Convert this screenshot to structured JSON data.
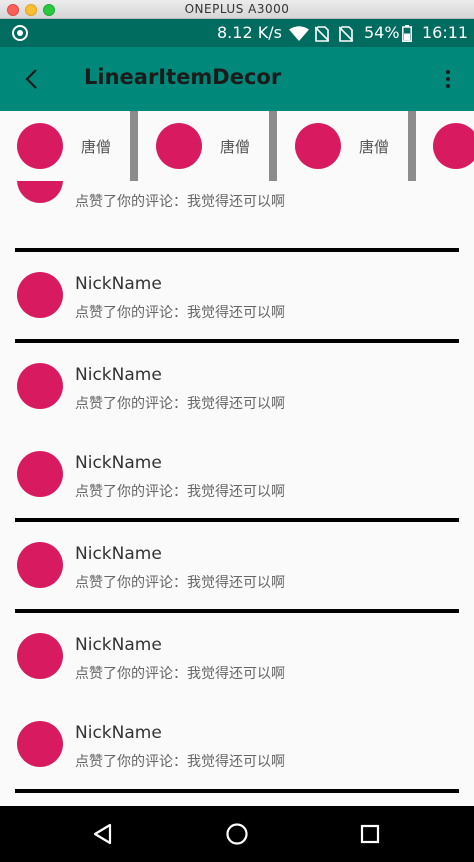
{
  "window": {
    "title": "ONEPLUS A3000"
  },
  "status_bar": {
    "net_speed": "8.12 K/s",
    "battery": "54%",
    "time": "16:11"
  },
  "app_bar": {
    "title": "LinearItemDecor"
  },
  "horizontal_list": {
    "items": [
      {
        "name": "唐僧"
      },
      {
        "name": "唐僧"
      },
      {
        "name": "唐僧"
      },
      {
        "name": ""
      }
    ]
  },
  "vertical_list": {
    "items": [
      {
        "nickname": "",
        "comment": "点赞了你的评论：我觉得还可以啊"
      },
      {
        "nickname": "NickName",
        "comment": "点赞了你的评论：我觉得还可以啊"
      },
      {
        "nickname": "NickName",
        "comment": "点赞了你的评论：我觉得还可以啊"
      },
      {
        "nickname": "NickName",
        "comment": "点赞了你的评论：我觉得还可以啊"
      },
      {
        "nickname": "NickName",
        "comment": "点赞了你的评论：我觉得还可以啊"
      },
      {
        "nickname": "NickName",
        "comment": "点赞了你的评论：我觉得还可以啊"
      },
      {
        "nickname": "NickName",
        "comment": "点赞了你的评论：我觉得还可以啊"
      }
    ]
  },
  "colors": {
    "status_bar": "#006b5f",
    "app_bar": "#00897b",
    "avatar": "#d81b60",
    "horizontal_divider": "#8c8c8c",
    "vertical_divider": "#000000"
  },
  "icons": {
    "status": [
      "app-notification-icon",
      "wifi-icon",
      "no-sim-icon",
      "no-sim-icon",
      "battery-icon"
    ],
    "app_bar": [
      "back-arrow-icon",
      "overflow-menu-icon"
    ],
    "nav_bar": [
      "back-triangle-icon",
      "home-circle-icon",
      "recents-square-icon"
    ]
  }
}
